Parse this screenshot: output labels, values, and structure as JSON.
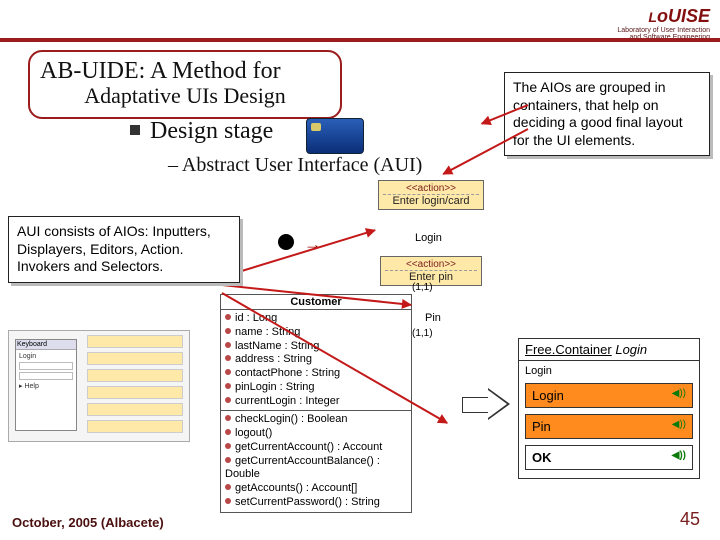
{
  "logo": {
    "brand": "LoUISE",
    "tag1": "Laboratory of User Interaction",
    "tag2": "and Software Engineering"
  },
  "title": {
    "line1": "AB-UIDE: A Method for",
    "line2": "Adaptative UIs Design"
  },
  "bullet": {
    "stage": "Design stage",
    "aui": "– Abstract User Interface (AUI)"
  },
  "callout_right": "The AIOs are grouped in containers, that help on deciding a good final layout for the UI elements.",
  "callout_left": "AUI consists of AIOs: Inputters, Displayers, Editors, Action. Invokers and Selectors.",
  "action1": {
    "hdr": "<<action>>",
    "body": "Enter login/card"
  },
  "action2": {
    "hdr": "<<action>>",
    "body": "Enter pin"
  },
  "labels": {
    "login": "Login",
    "pin": "Pin",
    "mult": "(1,1)"
  },
  "uml": {
    "name": "Customer",
    "attrs": [
      "id : Long",
      "name : String",
      "lastName : String",
      "address : String",
      "contactPhone : String",
      "pinLogin : String",
      "currentLogin : Integer"
    ],
    "ops": [
      "checkLogin() : Boolean",
      "logout()",
      "getCurrentAccount() : Account",
      "getCurrentAccountBalance() : Double",
      "getAccounts() : Account[]",
      "setCurrentPassword() : String"
    ]
  },
  "thumb": {
    "win_title": "Keyboard",
    "btn1": "Login",
    "btn2": "Help"
  },
  "freec": {
    "prefix": "Free.",
    "word": "Container",
    "param": "Login",
    "inner_label": "Login",
    "btn_login": "Login",
    "btn_pin": "Pin",
    "ok": "OK",
    "snd": "◀))"
  },
  "footer": {
    "left": "October, 2005 (Albacete)",
    "page": "45"
  }
}
